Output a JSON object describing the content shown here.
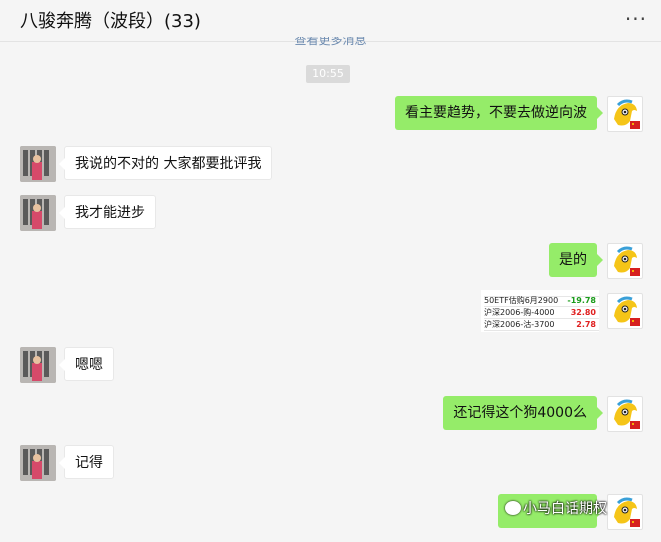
{
  "header": {
    "title": "八骏奔腾（波段）(33)",
    "more": "···"
  },
  "view_more": "查看更多消息",
  "time": "10:55",
  "messages": [
    {
      "side": "out",
      "text": "看主要趋势，不要去做逆向波"
    },
    {
      "side": "in",
      "text": "我说的不对的 大家都要批评我"
    },
    {
      "side": "in",
      "text": "我才能进步"
    },
    {
      "side": "out",
      "text": "是的"
    },
    {
      "side": "in",
      "text": "嗯嗯"
    },
    {
      "side": "out",
      "text": "还记得这个狗4000么"
    },
    {
      "side": "in",
      "text": "记得"
    }
  ],
  "image_message": {
    "rows": [
      {
        "name": "50ETF估购6月2900",
        "value": "-19.78",
        "color": "#1a9c1a"
      },
      {
        "name": "沪深2006-购-4000",
        "value": "32.80",
        "color": "#e02020"
      },
      {
        "name": "沪深2006-沽-3700",
        "value": "2.78",
        "color": "#e02020"
      }
    ]
  },
  "watermark": "小马白话期权",
  "colors": {
    "out_bubble": "#95ec69",
    "in_bubble": "#ffffff",
    "link": "#6d8bb0"
  }
}
